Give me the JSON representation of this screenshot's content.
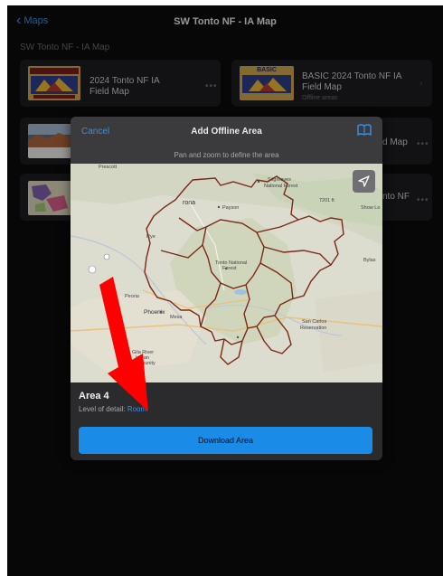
{
  "navbar": {
    "back_label": "Maps",
    "title": "SW Tonto NF - IA Map"
  },
  "section_title": "SW Tonto NF - IA Map",
  "cards": [
    {
      "title_line1": "2024 Tonto NF IA",
      "title_line2": "Field Map",
      "more": "•••"
    },
    {
      "title_line1": "BASIC 2024 Tonto NF IA",
      "title_line2": "Field Map",
      "subtitle": "Offline areas",
      "thumb_text": "BASIC",
      "chevron": "›"
    },
    {
      "title_partial": "d Map",
      "more": "•••"
    },
    {
      "title_partial": "nto NF",
      "more": "•••"
    }
  ],
  "modal": {
    "cancel_label": "Cancel",
    "title": "Add Offline Area",
    "subtitle": "Pan and zoom to define the area",
    "map_labels": {
      "prescott": "Prescott",
      "sitgreaves_1": "Sitgreaves",
      "sitgreaves_2": "National Forest",
      "elev_7201": "7201 ft",
      "payson": "Payson",
      "showlow": "Show Lo",
      "tonto_1": "Tonto National",
      "tonto_2": "Forest",
      "peoria": "Peoria",
      "phoenix": "Phoenix",
      "mesa": "Mesa",
      "sancarlos_1": "San Carlos",
      "sancarlos_2": "Reservation",
      "gilariver_1": "Gila River",
      "gilariver_2": "Indian",
      "gilariver_3": "Community",
      "rona": "rona",
      "rye": "Rye",
      "bylas": "Bylas"
    },
    "area_name": "Area 4",
    "lod_label": "Level of detail:",
    "lod_value": "Room",
    "download_label": "Download Area"
  },
  "colors": {
    "accent": "#1a8ce8",
    "link": "#3a8fe0",
    "boundary": "#7a2a18",
    "annotation_arrow": "#ff0000"
  }
}
